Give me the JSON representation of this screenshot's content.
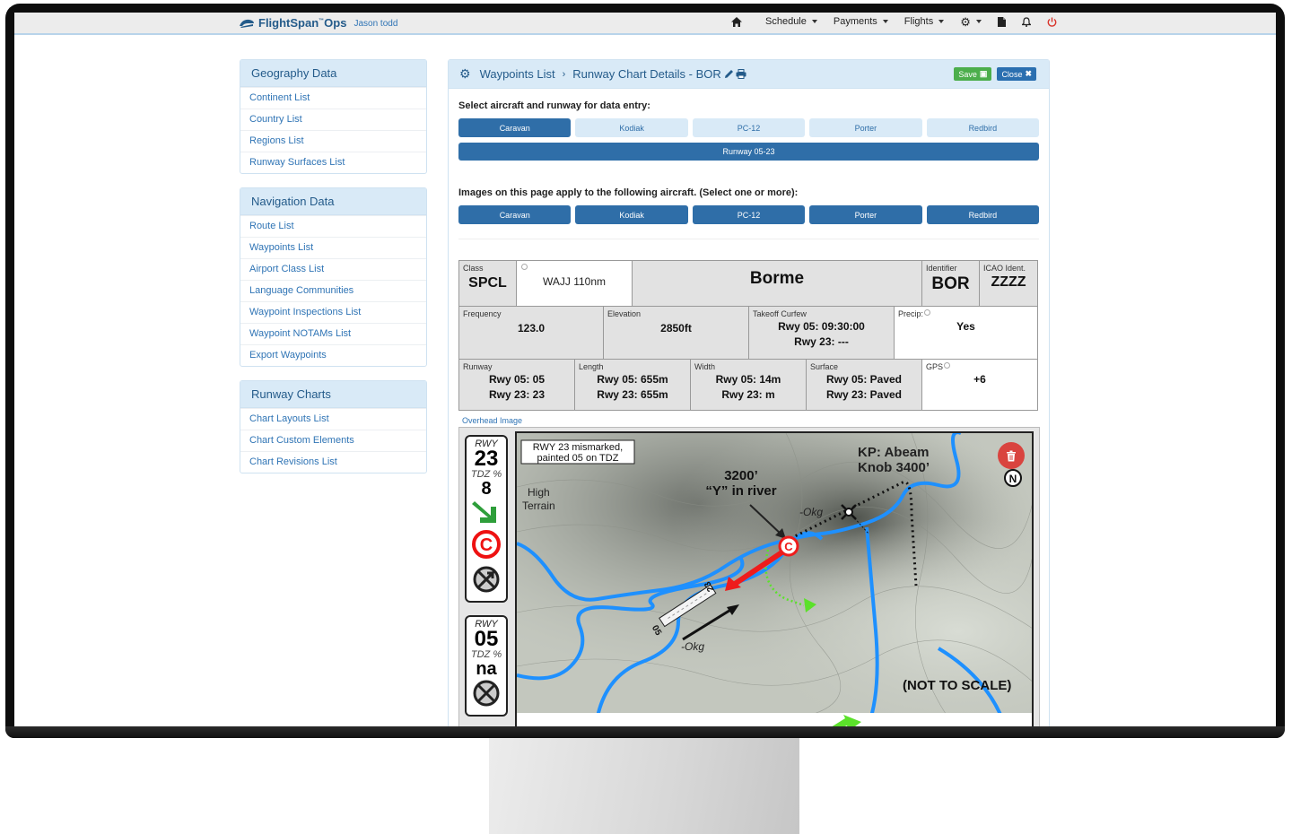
{
  "navbar": {
    "brand": "FlightSpan",
    "brand_suffix": "Ops",
    "user": "Jason todd",
    "items": [
      {
        "label": "Schedule",
        "dropdown": true
      },
      {
        "label": "Payments",
        "dropdown": true
      },
      {
        "label": "Flights",
        "dropdown": true
      }
    ],
    "icons": [
      "home-icon",
      "gear-icon",
      "document-icon",
      "bell-icon",
      "power-icon"
    ]
  },
  "sidebar": {
    "sections": [
      {
        "title": "Geography Data",
        "items": [
          "Continent List",
          "Country List",
          "Regions List",
          "Runway Surfaces List"
        ]
      },
      {
        "title": "Navigation Data",
        "items": [
          "Route List",
          "Waypoints List",
          "Airport Class List",
          "Language Communities",
          "Waypoint Inspections List",
          "Waypoint NOTAMs List",
          "Export Waypoints"
        ]
      },
      {
        "title": "Runway Charts",
        "items": [
          "Chart Layouts List",
          "Chart Custom Elements",
          "Chart Revisions List"
        ]
      }
    ]
  },
  "main": {
    "breadcrumb": {
      "parent": "Waypoints List",
      "current": "Runway Chart Details - BOR"
    },
    "save_label": "Save",
    "close_label": "Close",
    "select_label": "Select aircraft and runway for data entry:",
    "aircraft": [
      "Caravan",
      "Kodiak",
      "PC-12",
      "Porter",
      "Redbird"
    ],
    "selected_aircraft": "Caravan",
    "runway_label": "Runway 05-23",
    "images_label": "Images on this page apply to the following aircraft. (Select one or more):",
    "image_aircraft": [
      "Caravan",
      "Kodiak",
      "PC-12",
      "Porter",
      "Redbird"
    ]
  },
  "info": {
    "class_label": "Class",
    "class_value": "SPCL",
    "nearest": "WAJJ 110nm",
    "name": "Borme",
    "identifier_label": "Identifier",
    "identifier_value": "BOR",
    "icao_label": "ICAO Ident.",
    "icao_value": "ZZZZ",
    "frequency_label": "Frequency",
    "frequency_value": "123.0",
    "elevation_label": "Elevation",
    "elevation_value": "2850ft",
    "curfew_label": "Takeoff Curfew",
    "curfew_05": "Rwy 05: 09:30:00",
    "curfew_23": "Rwy 23: ---",
    "precip_label": "Precip:",
    "precip_value": "Yes",
    "runway_label": "Runway",
    "runway_05": "Rwy 05: 05",
    "runway_23": "Rwy 23: 23",
    "length_label": "Length",
    "length_05": "Rwy 05: 655m",
    "length_23": "Rwy 23: 655m",
    "width_label": "Width",
    "width_05": "Rwy 05: 14m",
    "width_23": "Rwy 23: m",
    "surface_label": "Surface",
    "surface_05": "Rwy 05: Paved",
    "surface_23": "Rwy 23: Paved",
    "gps_label": "GPS",
    "gps_value": "+6"
  },
  "chart": {
    "overhead_label": "Overhead Image",
    "legend": [
      {
        "rwy": "RWY",
        "number": "23",
        "tdz_label": "TDZ %",
        "tdz_value": "8"
      },
      {
        "rwy": "RWY",
        "number": "05",
        "tdz_label": "TDZ %",
        "tdz_value": "na"
      }
    ],
    "annotations": {
      "mismarked_1": "RWY 23 mismarked,",
      "mismarked_2": "painted 05 on TDZ",
      "high_terrain_1": "High",
      "high_terrain_2": "Terrain",
      "elev_1": "3200’",
      "elev_2": "“Y” in river",
      "kp_1": "KP: Abeam",
      "kp_2": "Knob 3400’",
      "okg_1": "-Okg",
      "okg_2": "-Okg",
      "rwy_05": "05",
      "rwy_23": "23",
      "not_to_scale": "(NOT TO SCALE)",
      "north": "N",
      "c_marker": "C"
    }
  }
}
